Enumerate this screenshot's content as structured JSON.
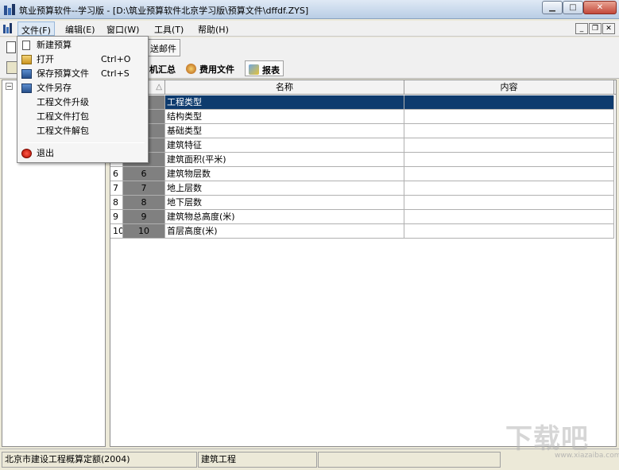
{
  "window": {
    "title": "筑业预算软件--学习版 - [D:\\筑业预算软件北京学习版\\预算文件\\dffdf.ZYS]",
    "min_glyph": "▁",
    "max_glyph": "□",
    "close_glyph": "✕"
  },
  "menubar": {
    "file": "文件(F)",
    "edit": "编辑(E)",
    "window": "窗口(W)",
    "tools": "工具(T)",
    "help": "帮助(H)",
    "mdi_min": "_",
    "mdi_restore": "❐",
    "mdi_close": "✕"
  },
  "file_menu": {
    "items": [
      {
        "label": "新建预算",
        "shortcut": ""
      },
      {
        "label": "打开",
        "shortcut": "Ctrl+O"
      },
      {
        "label": "保存预算文件",
        "shortcut": "Ctrl+S"
      },
      {
        "label": "文件另存",
        "shortcut": ""
      },
      {
        "label": "工程文件升级",
        "shortcut": ""
      },
      {
        "label": "工程文件打包",
        "shortcut": ""
      },
      {
        "label": "工程文件解包",
        "shortcut": ""
      },
      {
        "label": "退出",
        "shortcut": ""
      }
    ]
  },
  "toolbar": {
    "send_mail": "送邮件",
    "tab_machine": "机汇总",
    "tab_fee": "费用文件",
    "tab_report": "报表"
  },
  "tree": {
    "expander": "−"
  },
  "grid": {
    "sort_indicator": "△",
    "col_name": "名称",
    "col_content": "内容",
    "rows": [
      {
        "num": "",
        "seq": "",
        "name": "工程类型",
        "content": ""
      },
      {
        "num": "",
        "seq": "",
        "name": "结构类型",
        "content": ""
      },
      {
        "num": "",
        "seq": "",
        "name": "基础类型",
        "content": ""
      },
      {
        "num": "",
        "seq": "",
        "name": "建筑特征",
        "content": ""
      },
      {
        "num": "",
        "seq": "",
        "name": "建筑面积(平米)",
        "content": ""
      },
      {
        "num": "6",
        "seq": "6",
        "name": "建筑物层数",
        "content": ""
      },
      {
        "num": "7",
        "seq": "7",
        "name": "地上层数",
        "content": ""
      },
      {
        "num": "8",
        "seq": "8",
        "name": "地下层数",
        "content": ""
      },
      {
        "num": "9",
        "seq": "9",
        "name": "建筑物总高度(米)",
        "content": ""
      },
      {
        "num": "10",
        "seq": "10",
        "name": "首层高度(米)",
        "content": ""
      }
    ]
  },
  "statusbar": {
    "quota": "北京市建设工程概算定额(2004)",
    "project": "建筑工程",
    "extra": ""
  },
  "watermark": {
    "logo": "下载吧",
    "url": "www.xiazaiba.com"
  }
}
